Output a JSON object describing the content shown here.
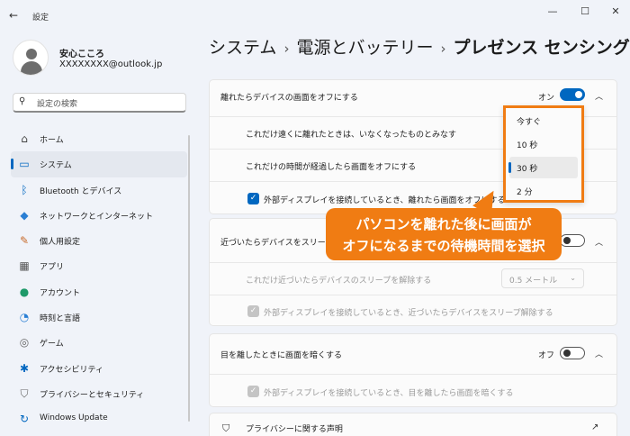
{
  "window": {
    "title": "設定",
    "minimize": "—",
    "maximize": "☐",
    "close": "✕"
  },
  "user": {
    "name": "安心こころ",
    "email": "XXXXXXXX@outlook.jp"
  },
  "search": {
    "placeholder": "設定の検索"
  },
  "sidebar": {
    "items": [
      {
        "label": "ホーム",
        "icon": "home-icon",
        "glyph": "⌂"
      },
      {
        "label": "システム",
        "icon": "monitor-icon",
        "glyph": "▭",
        "selected": true
      },
      {
        "label": "Bluetooth とデバイス",
        "icon": "bluetooth-icon",
        "glyph": "ᛒ"
      },
      {
        "label": "ネットワークとインターネット",
        "icon": "wifi-icon",
        "glyph": "◆"
      },
      {
        "label": "個人用設定",
        "icon": "brush-icon",
        "glyph": "✎"
      },
      {
        "label": "アプリ",
        "icon": "apps-icon",
        "glyph": "▦"
      },
      {
        "label": "アカウント",
        "icon": "account-icon",
        "glyph": "●"
      },
      {
        "label": "時刻と言語",
        "icon": "clock-globe-icon",
        "glyph": "◔"
      },
      {
        "label": "ゲーム",
        "icon": "gamepad-icon",
        "glyph": "◎"
      },
      {
        "label": "アクセシビリティ",
        "icon": "accessibility-icon",
        "glyph": "✱"
      },
      {
        "label": "プライバシーとセキュリティ",
        "icon": "shield-icon",
        "glyph": "⛉"
      },
      {
        "label": "Windows Update",
        "icon": "update-icon",
        "glyph": "↻"
      }
    ]
  },
  "breadcrumb": {
    "part1": "システム",
    "part2": "電源とバッテリー",
    "current": "プレゼンス センシング",
    "sep": "›"
  },
  "cards": {
    "away": {
      "title": "離れたらデバイスの画面をオフにする",
      "state": "オン",
      "row1": "これだけ遠くに離れたときは、いなくなったものとみなす",
      "row2": "これだけの時間が経過したら画面をオフにする",
      "checkbox": "外部ディスプレイを接続しているとき、離れたら画面をオフにする"
    },
    "near": {
      "title": "近づいたらデバイスをスリープ解除する",
      "row1": "これだけ近づいたらデバイスのスリープを解除する",
      "select_value": "0.5 メートル",
      "checkbox": "外部ディスプレイを接続しているとき、近づいたらデバイスをスリープ解除する"
    },
    "dim": {
      "title": "目を離したときに画面を暗くする",
      "state": "オフ",
      "checkbox": "外部ディスプレイを接続しているとき、目を離したら画面を暗くする"
    },
    "privacy": {
      "title": "プライバシーに関する声明"
    }
  },
  "dropdown": {
    "options": [
      {
        "label": "今すぐ"
      },
      {
        "label": "10 秒"
      },
      {
        "label": "30 秒",
        "selected": true
      },
      {
        "label": "2 分"
      }
    ]
  },
  "callout": {
    "line1": "パソコンを離れた後に画面が",
    "line2": "オフになるまでの待機時間を選択"
  },
  "colors": {
    "accent": "#0067c0",
    "callout": "#f07c13"
  }
}
